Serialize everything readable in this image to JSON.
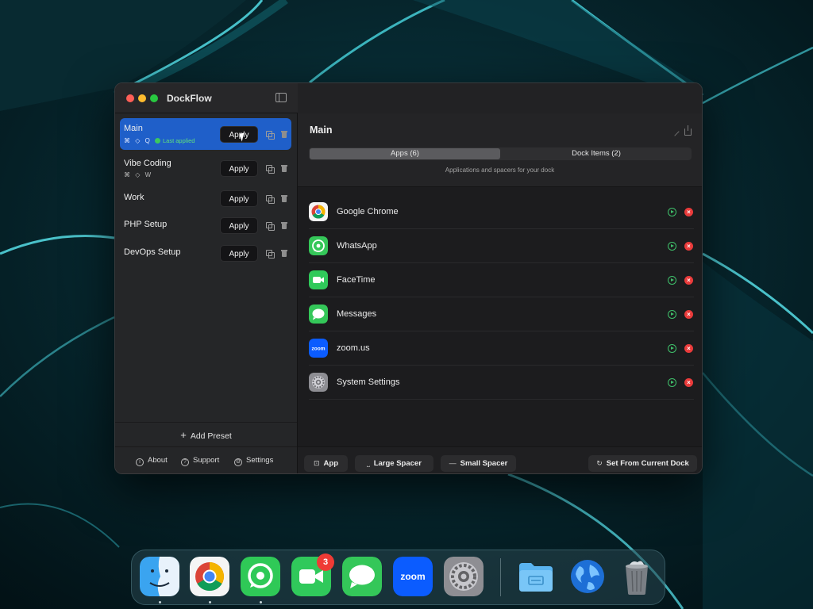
{
  "window": {
    "app_title": "DockFlow"
  },
  "sidebar": {
    "presets": [
      {
        "name": "Main",
        "shortcut": "⌘ ◇ Q",
        "status": "Last applied",
        "apply_label": "Apply",
        "active": true
      },
      {
        "name": "Vibe Coding",
        "shortcut": "⌘ ◇ W",
        "apply_label": "Apply"
      },
      {
        "name": "Work",
        "apply_label": "Apply"
      },
      {
        "name": "PHP Setup",
        "apply_label": "Apply"
      },
      {
        "name": "DevOps Setup",
        "apply_label": "Apply"
      }
    ],
    "add_preset_label": "Add Preset",
    "footer": {
      "about": "About",
      "support": "Support",
      "settings": "Settings"
    }
  },
  "main": {
    "title": "Main",
    "tabs": [
      {
        "label": "Apps (6)",
        "selected": true
      },
      {
        "label": "Dock Items (2)",
        "selected": false
      }
    ],
    "subtitle": "Applications and spacers for your dock",
    "apps": [
      {
        "name": "Google Chrome",
        "icon": "chrome-icon"
      },
      {
        "name": "WhatsApp",
        "icon": "whatsapp-icon"
      },
      {
        "name": "FaceTime",
        "icon": "facetime-icon"
      },
      {
        "name": "Messages",
        "icon": "messages-icon"
      },
      {
        "name": "zoom.us",
        "icon": "zoom-icon",
        "icon_text": "zoom"
      },
      {
        "name": "System Settings",
        "icon": "system-settings-icon"
      }
    ],
    "footer": {
      "add_app": "App",
      "large_spacer": "Large Spacer",
      "small_spacer": "Small Spacer",
      "set_from_dock": "Set From Current Dock"
    }
  },
  "dock": {
    "facetime_badge": "3",
    "zoom_label": "zoom"
  },
  "colors": {
    "accent": "#1f5fc9",
    "success": "#3cc85f",
    "danger": "#ea3b3b"
  }
}
